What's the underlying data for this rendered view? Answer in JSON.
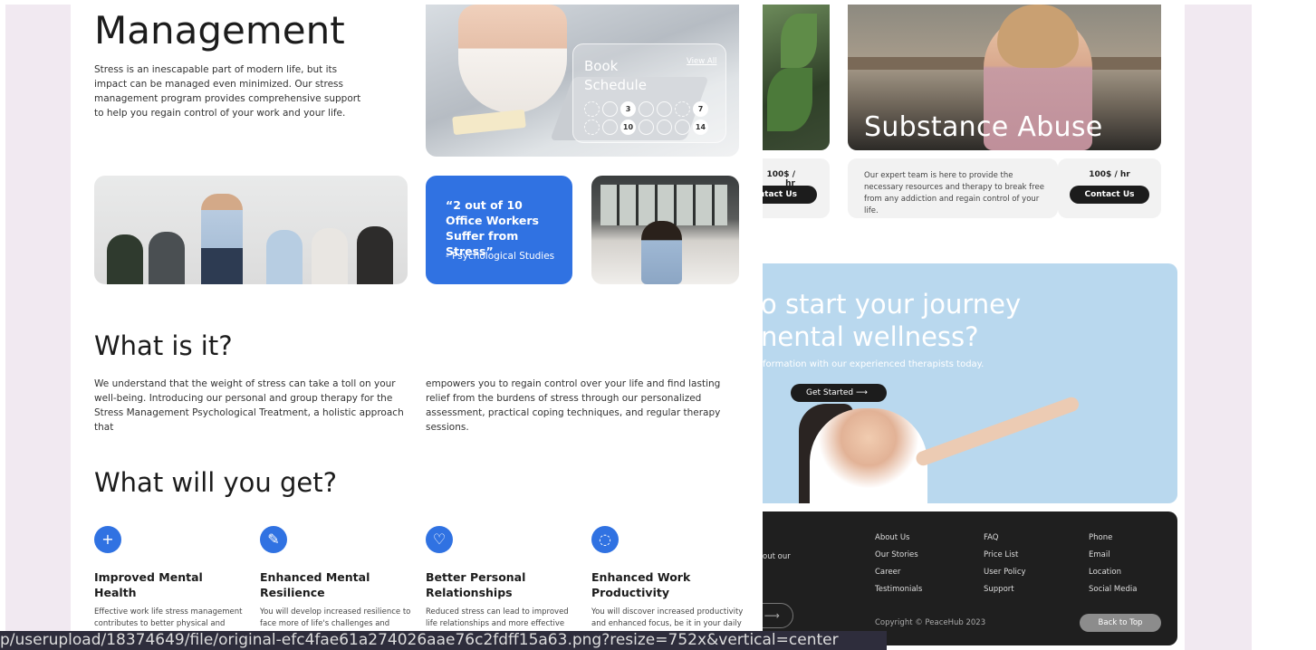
{
  "front": {
    "heading": "Management",
    "intro": "Stress is an inescapable part of modern life, but its impact can be managed even minimized. Our stress management program provides comprehensive support to help you regain control of your work and your life.",
    "schedule": {
      "title": "Book Schedule",
      "view_all": "View All",
      "row1": [
        "",
        "",
        "3",
        "",
        "",
        "",
        "7"
      ],
      "row2": [
        "",
        "",
        "10",
        "",
        "",
        "",
        "14"
      ]
    },
    "quote": {
      "text": "“2 out of 10 Office Workers Suffer from Stress”",
      "source": "- Psychological Studies"
    },
    "what_heading": "What is it?",
    "what_col1": "We understand that the weight of stress can take a toll on your well-being. Introducing our personal and group therapy for the Stress Management Psychological Treatment, a holistic approach that",
    "what_col2": "empowers you to regain control over your life and find lasting relief from the burdens of stress through our personalized assessment, practical coping techniques, and regular therapy sessions.",
    "get_heading": "What will you get?",
    "benefits": [
      {
        "icon": "plus-icon",
        "glyph": "+",
        "title": "Improved Mental Health",
        "desc": "Effective work life stress management contributes to better physical and"
      },
      {
        "icon": "resilience-icon",
        "glyph": "✎",
        "title": "Enhanced Mental Resilience",
        "desc": "You will develop increased resilience to face more of life's challenges and ready"
      },
      {
        "icon": "heart-icon",
        "glyph": "♡",
        "title": "Better Personal Relationships",
        "desc": "Reduced stress can lead to improved life relationships and more effective"
      },
      {
        "icon": "lightbulb-icon",
        "glyph": "◌",
        "title": "Enhanced Work Productivity",
        "desc": "You will discover increased productivity and enhanced focus, be it in your daily"
      }
    ]
  },
  "back": {
    "left_price": "100$ / hr",
    "left_contact": "Contact Us",
    "sub_title": "Substance Abuse",
    "sub_desc": "Our expert team is here to provide the necessary resources and therapy to break free from any addiction and regain control of your life.",
    "sub_price": "100$ / hr",
    "sub_contact": "Contact Us",
    "cta_line1": "o start your journey",
    "cta_line2": "nental wellness?",
    "cta_sub": "formation with our experienced therapists today.",
    "cta_button": "Get Started  ⟶",
    "footer": {
      "about_fragment": "out our",
      "col1": [
        "About Us",
        "Our Stories",
        "Career",
        "Testimonials"
      ],
      "col2": [
        "FAQ",
        "Price List",
        "User Policy",
        "Support"
      ],
      "col3": [
        "Phone",
        "Email",
        "Location",
        "Social Media"
      ],
      "copyright": "Copyright © PeaceHub 2023",
      "back_to_top": "Back to Top",
      "arrow": "⟶"
    }
  },
  "status_url": "p/userupload/18374649/file/original-efc4fae61a274026aae76c2fdff15a63.png?resize=752x&vertical=center"
}
